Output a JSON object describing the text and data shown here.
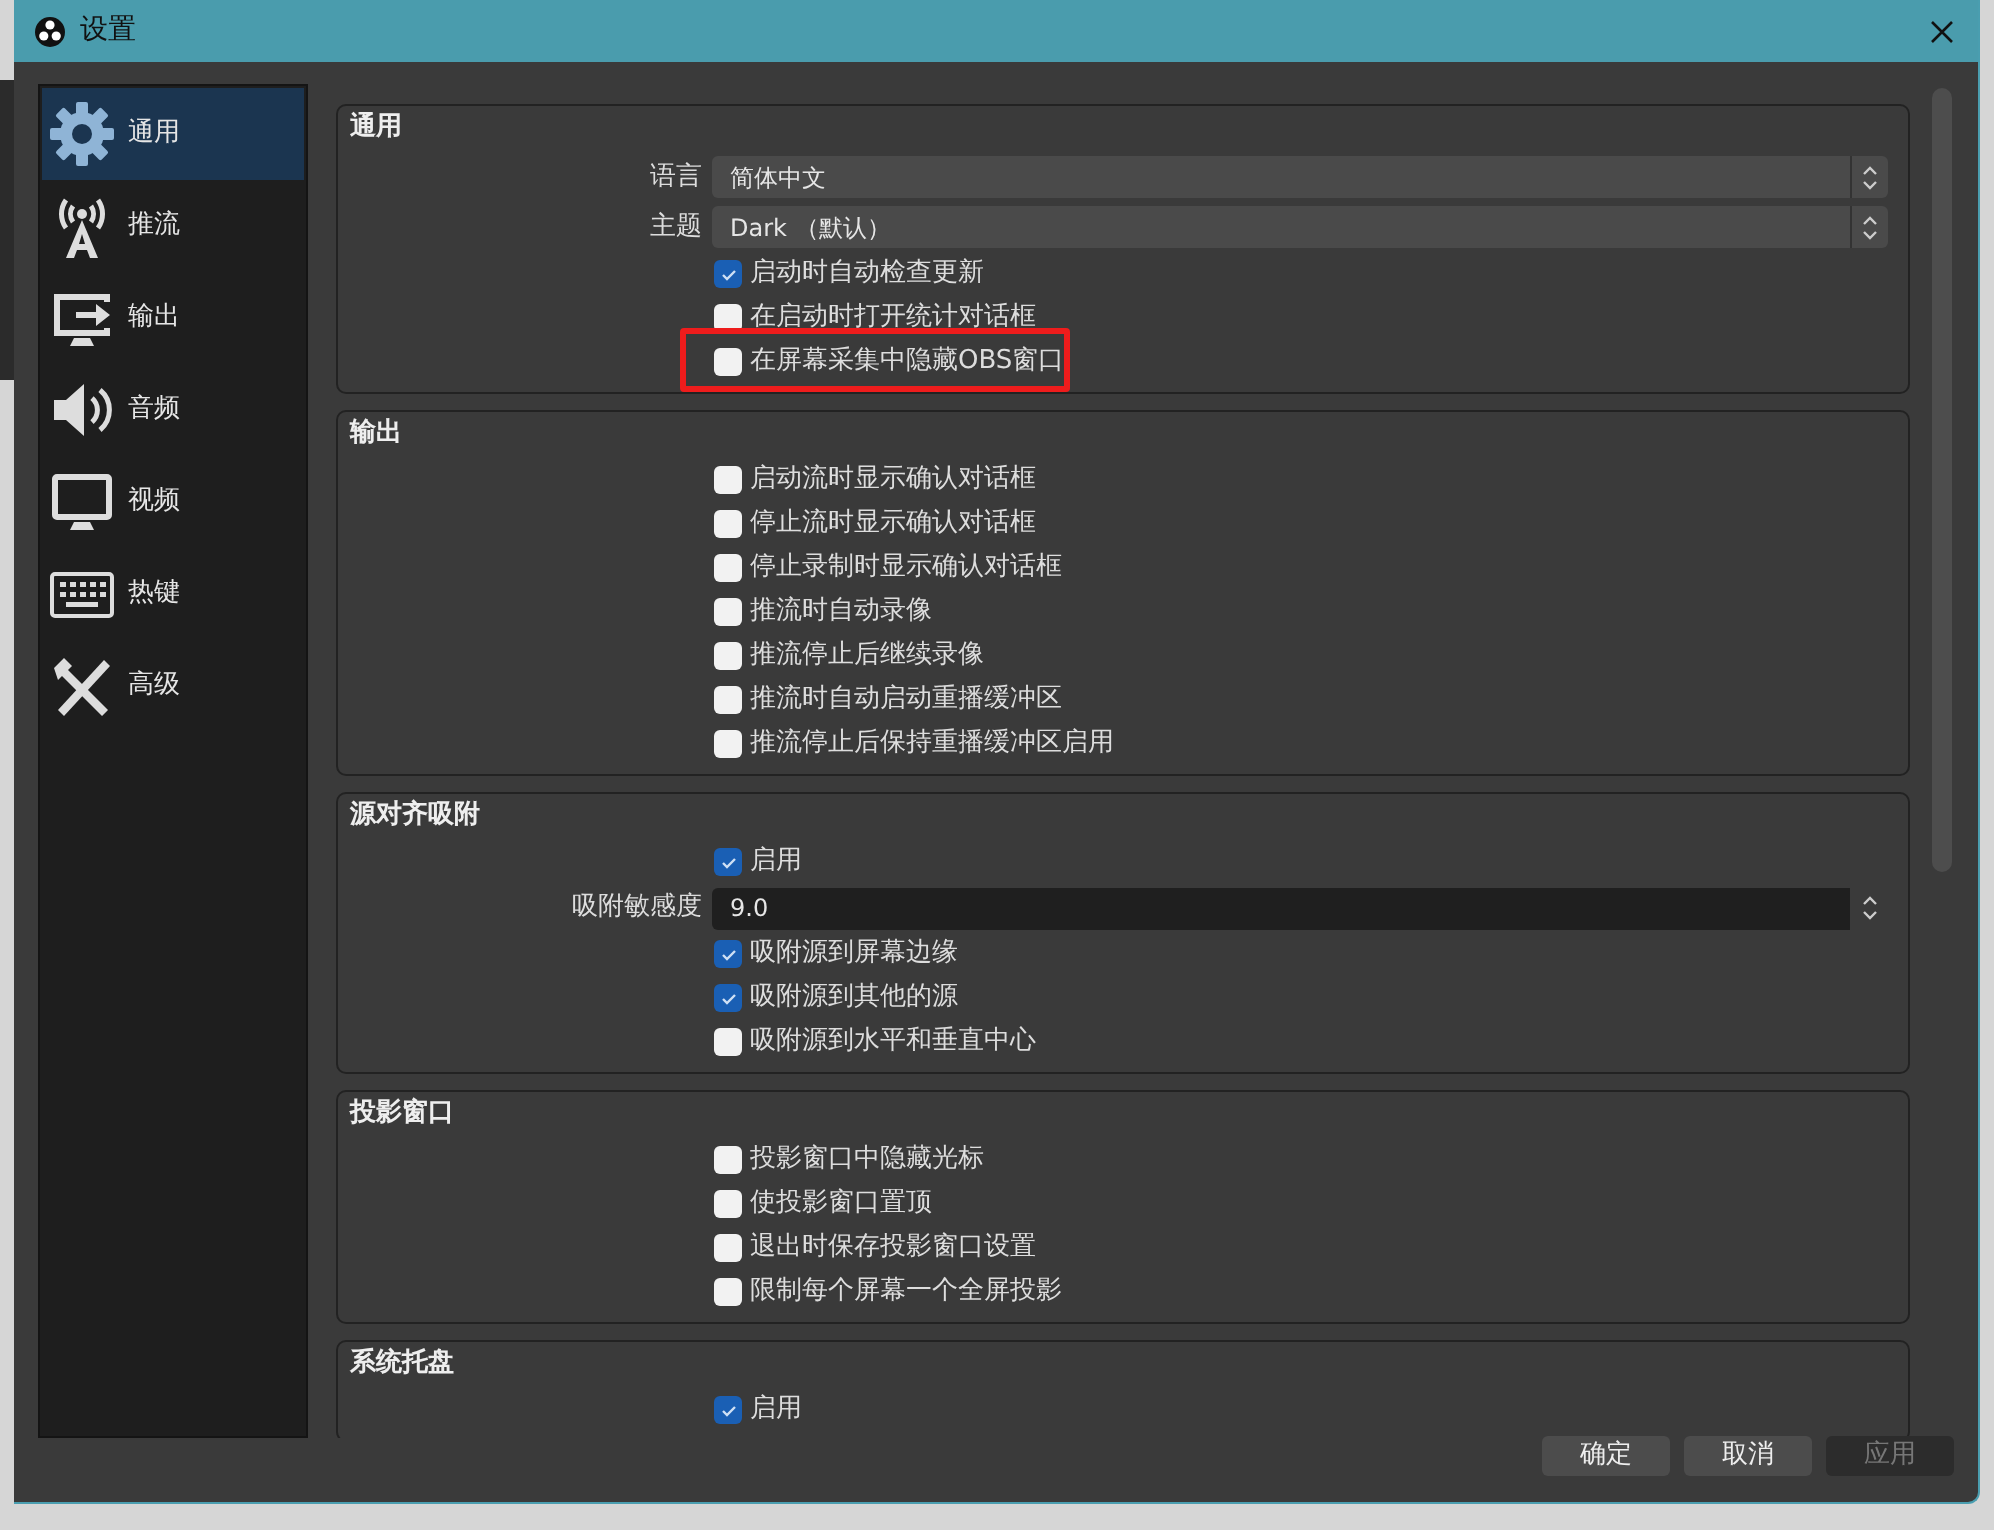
{
  "window": {
    "title": "设置"
  },
  "sidebar": {
    "items": [
      {
        "label": "通用",
        "selected": true
      },
      {
        "label": "推流",
        "selected": false
      },
      {
        "label": "输出",
        "selected": false
      },
      {
        "label": "音频",
        "selected": false
      },
      {
        "label": "视频",
        "selected": false
      },
      {
        "label": "热键",
        "selected": false
      },
      {
        "label": "高级",
        "selected": false
      }
    ]
  },
  "sections": [
    {
      "title": "通用",
      "rows": [
        {
          "kind": "select",
          "label": "语言",
          "value": "简体中文"
        },
        {
          "kind": "select",
          "label": "主题",
          "value": "Dark （默认）"
        },
        {
          "kind": "checkbox",
          "label": "启动时自动检查更新",
          "checked": true
        },
        {
          "kind": "checkbox",
          "label": "在启动时打开统计对话框",
          "checked": false
        },
        {
          "kind": "checkbox",
          "label": "在屏幕采集中隐藏OBS窗口",
          "checked": false,
          "highlighted": true
        }
      ]
    },
    {
      "title": "输出",
      "rows": [
        {
          "kind": "checkbox",
          "label": "启动流时显示确认对话框",
          "checked": false
        },
        {
          "kind": "checkbox",
          "label": "停止流时显示确认对话框",
          "checked": false
        },
        {
          "kind": "checkbox",
          "label": "停止录制时显示确认对话框",
          "checked": false
        },
        {
          "kind": "checkbox",
          "label": "推流时自动录像",
          "checked": false
        },
        {
          "kind": "checkbox",
          "label": "推流停止后继续录像",
          "checked": false
        },
        {
          "kind": "checkbox",
          "label": "推流时自动启动重播缓冲区",
          "checked": false
        },
        {
          "kind": "checkbox",
          "label": "推流停止后保持重播缓冲区启用",
          "checked": false
        }
      ]
    },
    {
      "title": "源对齐吸附",
      "rows": [
        {
          "kind": "checkbox",
          "label": "启用",
          "checked": true
        },
        {
          "kind": "spinbox",
          "label": "吸附敏感度",
          "value": "9.0"
        },
        {
          "kind": "checkbox",
          "label": "吸附源到屏幕边缘",
          "checked": true
        },
        {
          "kind": "checkbox",
          "label": "吸附源到其他的源",
          "checked": true
        },
        {
          "kind": "checkbox",
          "label": "吸附源到水平和垂直中心",
          "checked": false
        }
      ]
    },
    {
      "title": "投影窗口",
      "rows": [
        {
          "kind": "checkbox",
          "label": "投影窗口中隐藏光标",
          "checked": false
        },
        {
          "kind": "checkbox",
          "label": "使投影窗口置顶",
          "checked": false
        },
        {
          "kind": "checkbox",
          "label": "退出时保存投影窗口设置",
          "checked": false
        },
        {
          "kind": "checkbox",
          "label": "限制每个屏幕一个全屏投影",
          "checked": false
        }
      ]
    },
    {
      "title": "系统托盘",
      "rows": [
        {
          "kind": "checkbox",
          "label": "启用",
          "checked": true
        }
      ]
    }
  ],
  "buttons": [
    {
      "label": "确定",
      "disabled": false
    },
    {
      "label": "取消",
      "disabled": false
    },
    {
      "label": "应用",
      "disabled": true
    }
  ]
}
